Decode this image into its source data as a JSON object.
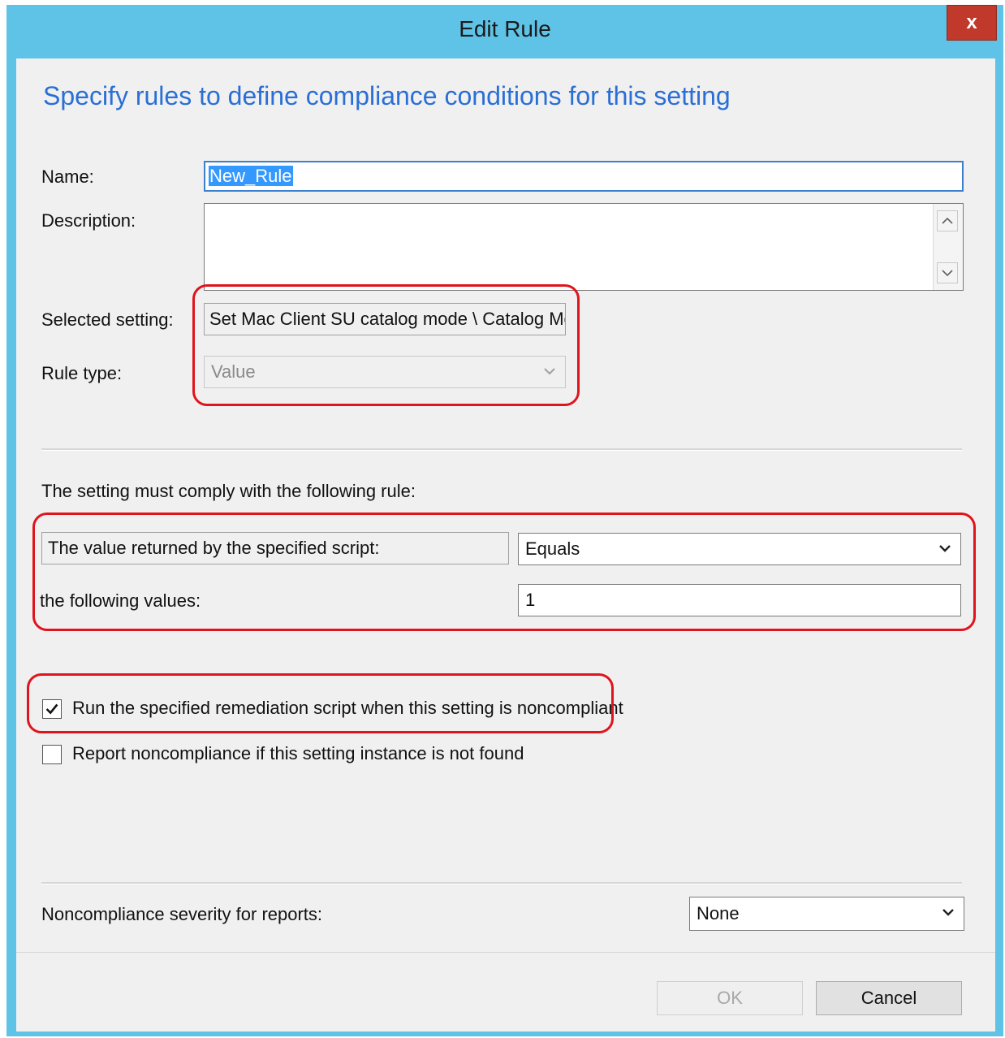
{
  "window": {
    "title": "Edit Rule",
    "close_label": "x"
  },
  "heading": "Specify rules to define compliance conditions for this setting",
  "form": {
    "name_label": "Name:",
    "name_value": "New_Rule",
    "description_label": "Description:",
    "description_value": "",
    "selected_setting_label": "Selected setting:",
    "selected_setting_value": "Set Mac Client SU catalog mode \\ Catalog Mc",
    "rule_type_label": "Rule type:",
    "rule_type_value": "Value"
  },
  "rule": {
    "intro": "The setting must comply with the following rule:",
    "source_label": "The value returned by the specified script:",
    "operator_value": "Equals",
    "values_label": "the following values:",
    "values_value": "1"
  },
  "options": {
    "remediate_label": "Run the specified remediation script when this setting is noncompliant",
    "remediate_checked": true,
    "report_label": "Report noncompliance if this setting instance is not found",
    "report_checked": false
  },
  "severity": {
    "label": "Noncompliance severity for reports:",
    "value": "None"
  },
  "buttons": {
    "ok": "OK",
    "cancel": "Cancel"
  },
  "colors": {
    "title_bar": "#5ec3e6",
    "heading": "#2a6fd6",
    "highlight": "#e0141c",
    "close": "#c0392b"
  }
}
